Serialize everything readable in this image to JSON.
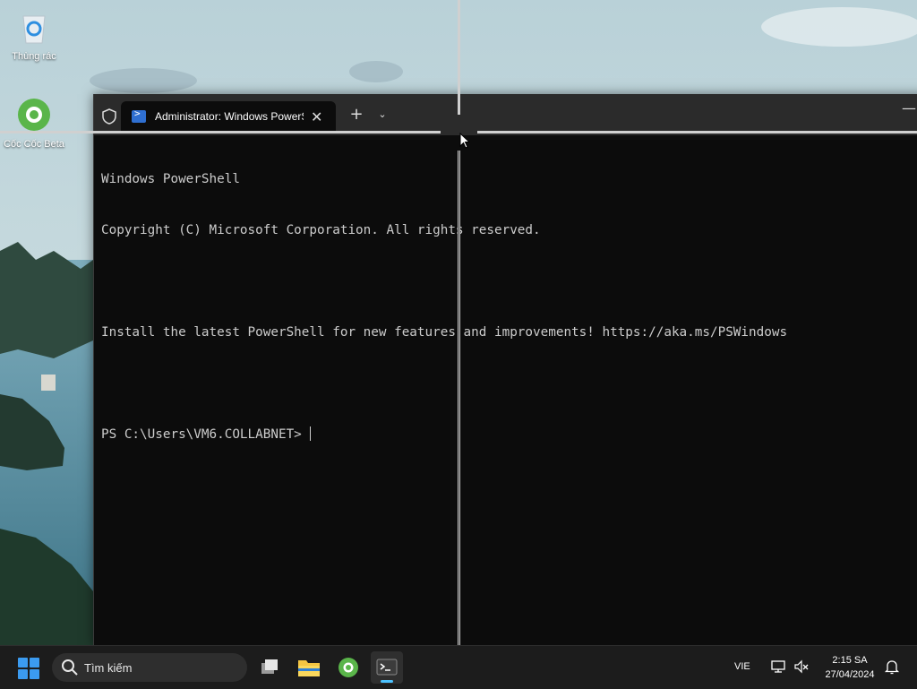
{
  "desktop": {
    "icons": [
      {
        "label": "Thùng rác"
      },
      {
        "label": "Cốc Cốc Beta"
      }
    ]
  },
  "window": {
    "tab_title": "Administrator: Windows PowerShell",
    "new_tab_symbol": "+",
    "close_symbol": "✕",
    "dropdown_symbol": "⌄",
    "minimize_symbol": "—",
    "console_lines": [
      "Windows PowerShell",
      "Copyright (C) Microsoft Corporation. All rights reserved.",
      "",
      "Install the latest PowerShell for new features and improvements! https://aka.ms/PSWindows",
      "",
      "PS C:\\Users\\VM6.COLLABNET> "
    ]
  },
  "taskbar": {
    "search_placeholder": "Tìm kiếm",
    "language": "VIE",
    "time": "2:15 SA",
    "date": "27/04/2024"
  },
  "colors": {
    "accent": "#4cc2ff",
    "console_bg": "#0c0c0c",
    "console_fg": "#cccccc",
    "taskbar_bg": "#1c1c1c"
  }
}
